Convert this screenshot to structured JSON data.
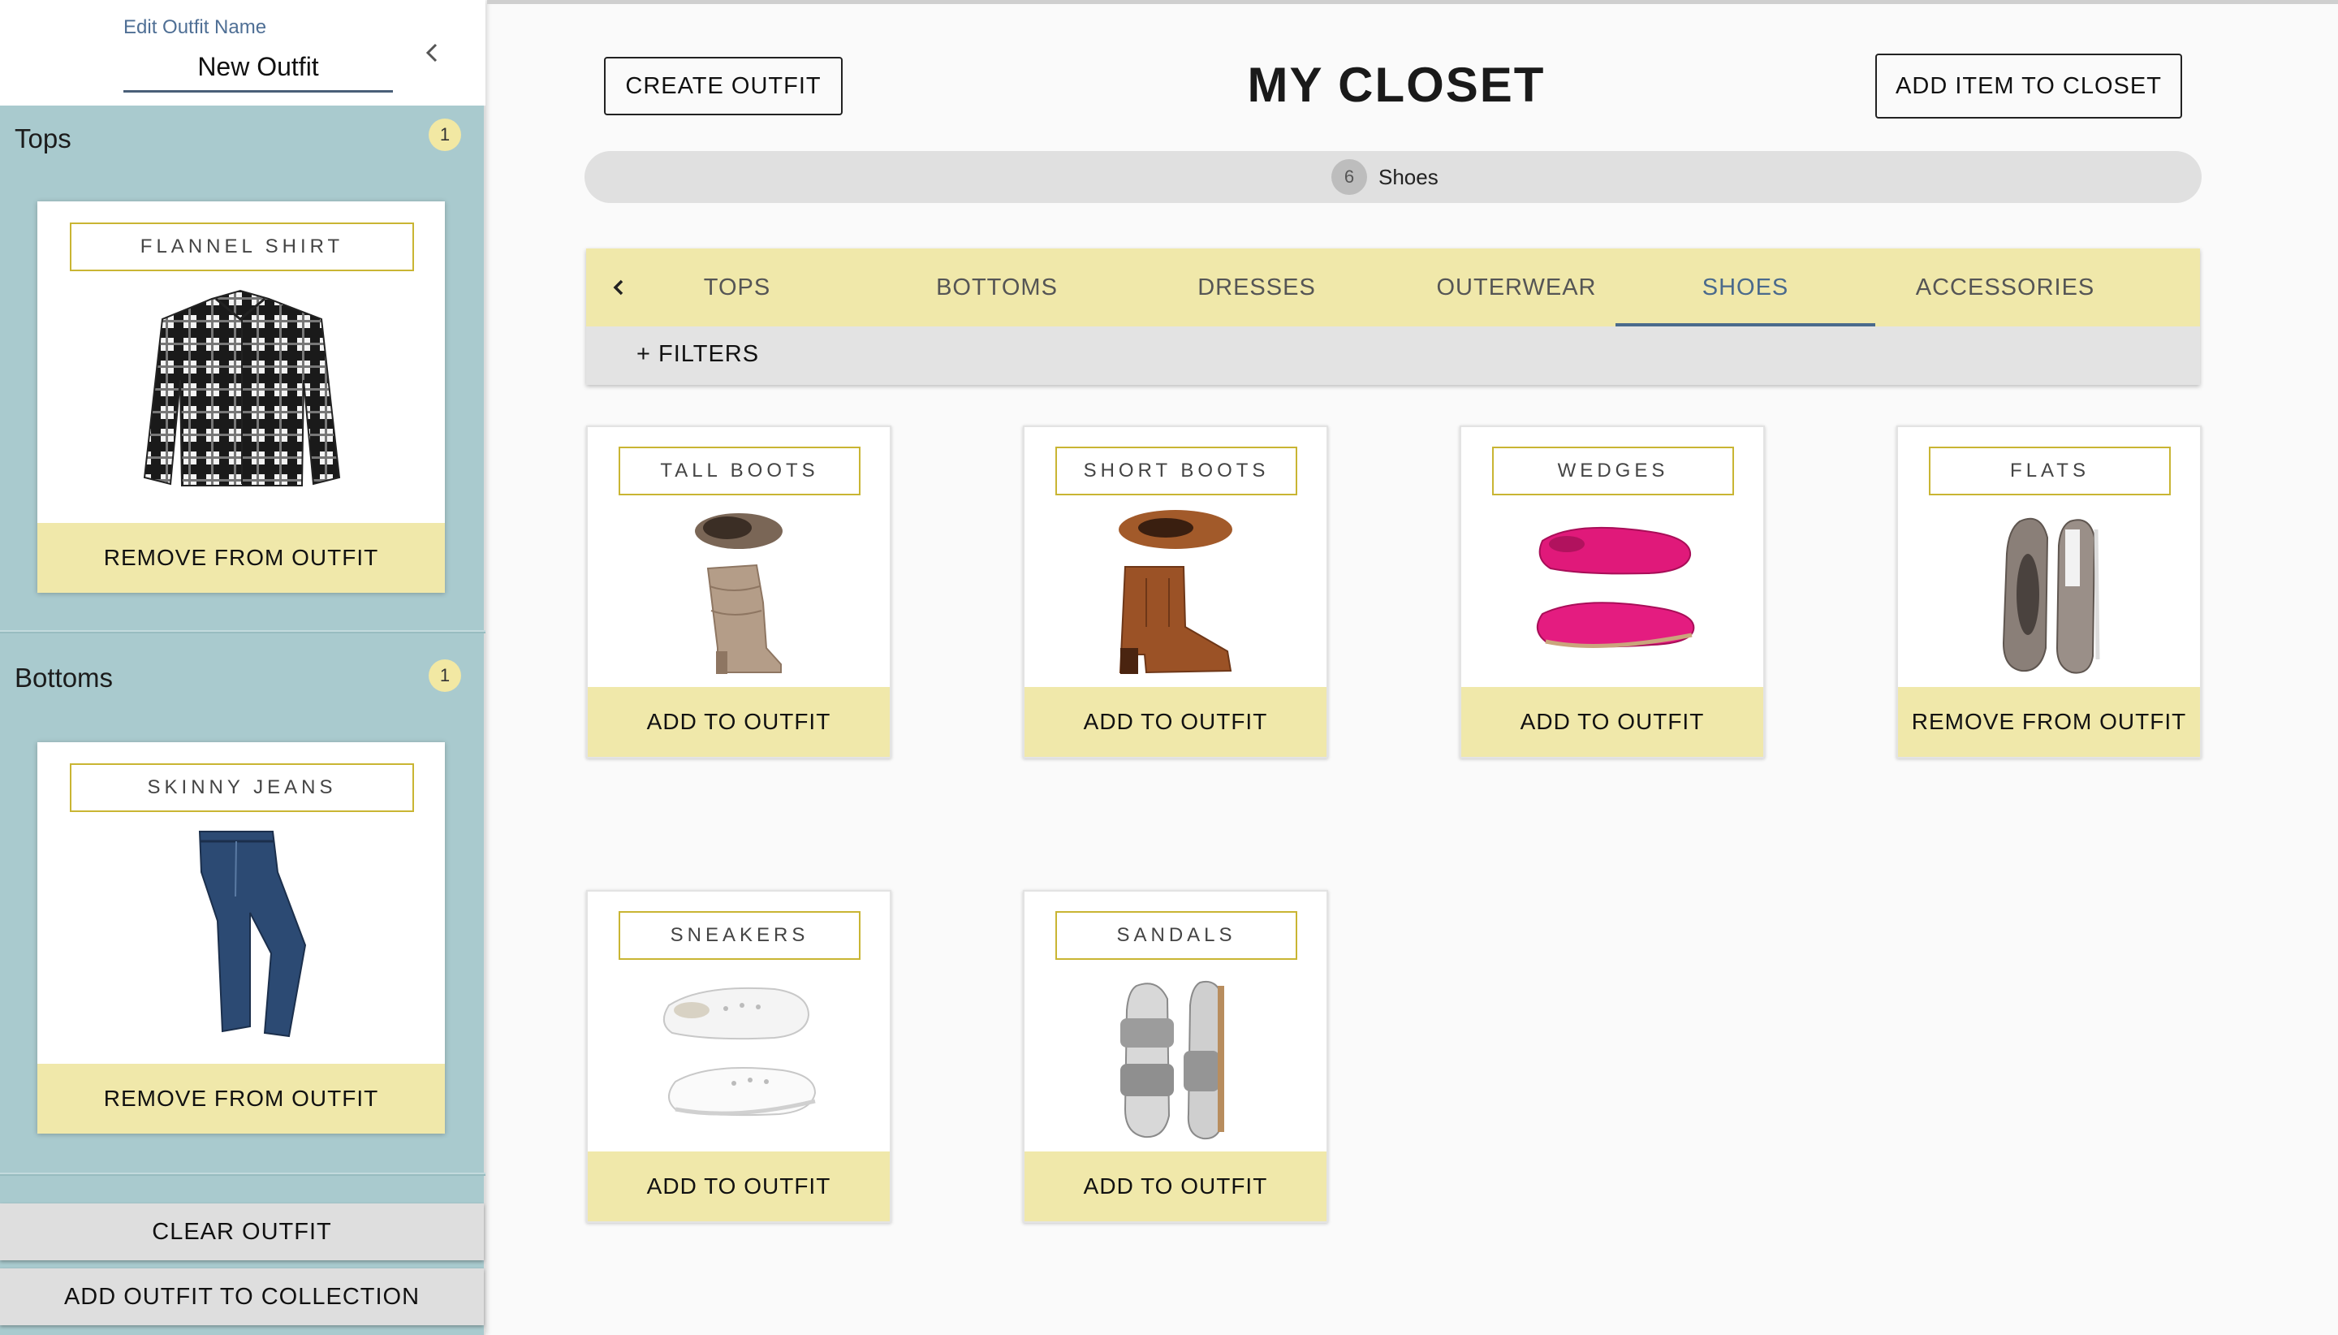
{
  "sidebar": {
    "outfit_name_label": "Edit Outfit Name",
    "outfit_name_value": "New Outfit",
    "sections": [
      {
        "title": "Tops",
        "count": "1",
        "item": {
          "label": "FLANNEL SHIRT",
          "action": "REMOVE FROM OUTFIT",
          "icon": "flannel-shirt-image"
        }
      },
      {
        "title": "Bottoms",
        "count": "1",
        "item": {
          "label": "SKINNY JEANS",
          "action": "REMOVE FROM OUTFIT",
          "icon": "skinny-jeans-image"
        }
      }
    ],
    "clear_label": "CLEAR OUTFIT",
    "add_collection_label": "ADD OUTFIT TO COLLECTION"
  },
  "header": {
    "create_outfit_label": "CREATE OUTFIT",
    "title": "MY CLOSET",
    "add_item_label": "ADD ITEM TO CLOSET"
  },
  "filter_chip": {
    "count": "6",
    "label": "Shoes"
  },
  "tabs": [
    {
      "label": "TOPS"
    },
    {
      "label": "BOTTOMS"
    },
    {
      "label": "DRESSES"
    },
    {
      "label": "OUTERWEAR"
    },
    {
      "label": "SHOES"
    },
    {
      "label": "ACCESSORIES"
    }
  ],
  "active_tab": "SHOES",
  "filters_label": "+ FILTERS",
  "items": [
    {
      "label": "TALL BOOTS",
      "action": "ADD TO OUTFIT",
      "icon": "tall-boots-image"
    },
    {
      "label": "SHORT BOOTS",
      "action": "ADD TO OUTFIT",
      "icon": "short-boots-image"
    },
    {
      "label": "WEDGES",
      "action": "ADD TO OUTFIT",
      "icon": "wedges-image"
    },
    {
      "label": "FLATS",
      "action": "REMOVE FROM OUTFIT",
      "icon": "flats-image"
    },
    {
      "label": "SNEAKERS",
      "action": "ADD TO OUTFIT",
      "icon": "sneakers-image"
    },
    {
      "label": "SANDALS",
      "action": "ADD TO OUTFIT",
      "icon": "sandals-image"
    }
  ],
  "colors": {
    "sidebar_bg": "#a9cace",
    "accent_yellow": "#f0e8aa",
    "label_border": "#c9b533",
    "active_tab": "#4a6a8c"
  }
}
